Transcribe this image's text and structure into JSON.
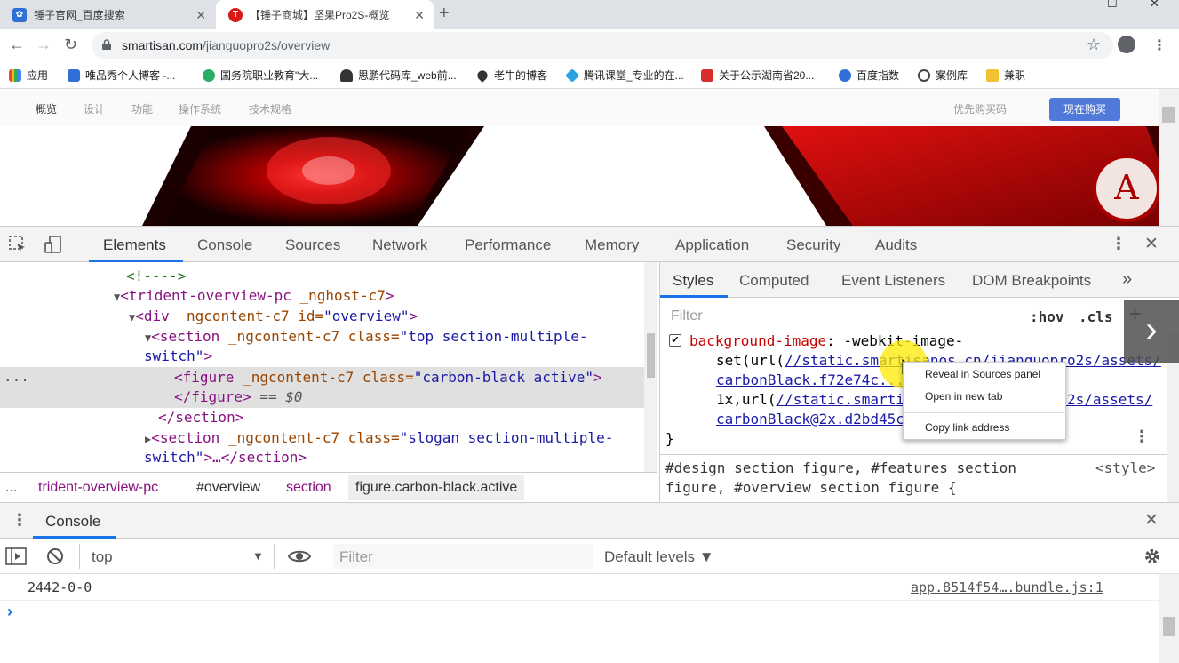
{
  "browser": {
    "tabs": [
      {
        "title": "锤子官网_百度搜索",
        "active": false
      },
      {
        "title": "【锤子商城】坚果Pro2S-概览",
        "active": true
      }
    ],
    "new_tab": "+",
    "window_controls": {
      "minimize": "—",
      "maximize": "☐",
      "close": "✕"
    },
    "url_host": "smartisan.com",
    "url_path": "/jianguopro2s/overview",
    "bookmarks": [
      {
        "label": "应用",
        "color": "#1a73e8"
      },
      {
        "label": "唯品秀个人博客 -...",
        "color": "#2f6fd6"
      },
      {
        "label": "国务院职业教育\"大...",
        "color": "#2aae67"
      },
      {
        "label": "思鹏代码库_web前...",
        "color": "#333333"
      },
      {
        "label": "老牛的博客",
        "color": "#333333"
      },
      {
        "label": "腾讯课堂_专业的在...",
        "color": "#29a3e0"
      },
      {
        "label": "关于公示湖南省20...",
        "color": "#d62d2d"
      },
      {
        "label": "百度指数",
        "color": "#2f6fd6"
      },
      {
        "label": "案例库",
        "color": "#444444"
      },
      {
        "label": "兼职",
        "color": "#f2c230"
      }
    ]
  },
  "site": {
    "nav": [
      "概览",
      "设计",
      "功能",
      "操作系统",
      "技术规格"
    ],
    "prebuy": "优先购买码",
    "buy": "现在购买"
  },
  "devtools": {
    "tabs": [
      "Elements",
      "Console",
      "Sources",
      "Network",
      "Performance",
      "Memory",
      "Application",
      "Security",
      "Audits"
    ],
    "active_tab": "Elements",
    "dom": {
      "l0": "<!---->",
      "l1_tag": "<trident-overview-pc",
      "l1_attr": " _nghost-c7",
      "l1_end": ">",
      "l2_tag": "<div",
      "l2_attr": " _ngcontent-c7 id=",
      "l2_val": "\"overview\"",
      "l2_end": ">",
      "l3_tag": "<section",
      "l3_attr": " _ngcontent-c7 class=",
      "l3_val": "\"top section-multiple-",
      "l3b_val": "switch\"",
      "l3b_end": ">",
      "l4_tag": "<figure",
      "l4_attr": " _ngcontent-c7 class=",
      "l4_val": "\"carbon-black active\"",
      "l4_end": ">",
      "l5_tag": "</figure>",
      "l5_eq": " == $0",
      "l6_tag": "</section>",
      "l7_tag": "<section",
      "l7_attr": " _ngcontent-c7 class=",
      "l7_val": "\"slogan section-multiple-",
      "l8_val": "switch\"",
      "l8_end": ">…</section>",
      "sel_marker": "..."
    },
    "breadcrumbs": [
      "...",
      "trident-overview-pc",
      "#overview",
      "section",
      "figure.carbon-black.active"
    ],
    "styles_tabs": [
      "Styles",
      "Computed",
      "Event Listeners",
      "DOM Breakpoints",
      "»"
    ],
    "filter_placeholder": "Filter",
    "hov": ":hov",
    "cls": ".cls",
    "plus": "+",
    "rule": {
      "prop": "background-image",
      "colon": ": ",
      "v1": "-webkit-image-",
      "v2": "set(url(",
      "v2_link": "//static.smartisanos.cn/jianguopro2s/assets/",
      "v3_link": "carbonBlack.f72e74c...",
      "v4": "1x,url(",
      "v4_link": "//static.smartisanos.cn/jianguopro2s/assets/",
      "v5_link": "carbonBlack@2x.d2bd45c...",
      "close": "}"
    },
    "rule2": {
      "selector_a": "#design section figure, #features section",
      "selector_b": "figure, #overview section figure {",
      "source": "<style>"
    },
    "context_menu": [
      "Reveal in Sources panel",
      "Open in new tab",
      "Copy link address"
    ]
  },
  "drawer": {
    "title": "Console",
    "context": "top",
    "filter_placeholder": "Filter",
    "levels": "Default levels ▼",
    "log_text": "2442-0-0",
    "log_source": "app.8514f54….bundle.js:1",
    "prompt": "›"
  }
}
